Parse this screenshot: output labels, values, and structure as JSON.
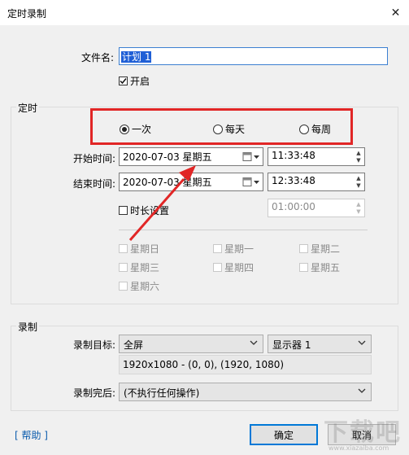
{
  "window": {
    "title": "定时录制",
    "close_glyph": "✕"
  },
  "file": {
    "label": "文件名:",
    "value": "计划 1",
    "enable_label": "开启",
    "enabled": true
  },
  "schedule": {
    "group_label": "定时",
    "radio_options": [
      "一次",
      "每天",
      "每周"
    ],
    "selected": "一次",
    "start_label": "开始时间:",
    "start_date": "2020-07-03 星期五",
    "start_time": "11:33:48",
    "end_label": "结束时间:",
    "end_date": "2020-07-03 星期五",
    "end_time": "12:33:48",
    "duration_label": "时长设置",
    "duration_value": "01:00:00",
    "days": [
      "星期日",
      "星期一",
      "星期二",
      "星期三",
      "星期四",
      "星期五",
      "星期六"
    ]
  },
  "record": {
    "group_label": "录制",
    "target_label": "录制目标:",
    "target_value": "全屏",
    "monitor_value": "显示器 1",
    "resolution_info": "1920x1080 - (0, 0), (1920, 1080)",
    "after_label": "录制完后:",
    "after_value": "(不执行任何操作)"
  },
  "footer": {
    "help_label": "[ 帮助 ]",
    "ok_label": "确定",
    "cancel_label": "取消"
  },
  "watermark": {
    "text": "下载吧",
    "url": "www.xiazaiba.com"
  },
  "colors": {
    "annotation": "#e12626",
    "selection": "#1f5fd6",
    "link": "#0b5cad",
    "default_button": "#0078d7"
  },
  "icons": {
    "calendar": "calendar-icon",
    "dropdown": "chevron-down-icon",
    "spin": "spin-updown-icon"
  }
}
